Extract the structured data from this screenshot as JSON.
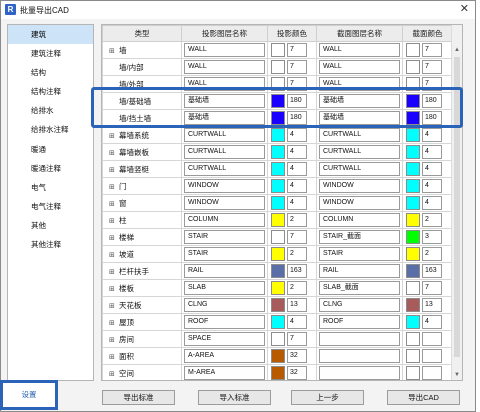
{
  "window": {
    "title": "批量导出CAD",
    "app_icon_letter": "R",
    "close_glyph": "✕"
  },
  "sidebar": {
    "items": [
      {
        "label": "建筑",
        "active": true
      },
      {
        "label": "建筑注释"
      },
      {
        "label": "结构"
      },
      {
        "label": "结构注释"
      },
      {
        "label": "给排水"
      },
      {
        "label": "给排水注释"
      },
      {
        "label": "暖通"
      },
      {
        "label": "暖通注释"
      },
      {
        "label": "电气"
      },
      {
        "label": "电气注释"
      },
      {
        "label": "其他"
      },
      {
        "label": "其他注释"
      }
    ]
  },
  "table": {
    "headers": [
      "类型",
      "投影图层名称",
      "投影颜色",
      "截面图层名称",
      "截面颜色"
    ],
    "rows": [
      {
        "type": "墙",
        "expand": "⊞",
        "proj_layer": "WALL",
        "proj_color": "#ffffff",
        "proj_num": "7",
        "sec_layer": "WALL",
        "sec_color": "#ffffff",
        "sec_num": "7"
      },
      {
        "type": "墙/内部",
        "expand": "",
        "proj_layer": "WALL",
        "proj_color": "#ffffff",
        "proj_num": "7",
        "sec_layer": "WALL",
        "sec_color": "#ffffff",
        "sec_num": "7"
      },
      {
        "type": "墙/外部",
        "expand": "",
        "proj_layer": "WALL",
        "proj_color": "#ffffff",
        "proj_num": "7",
        "sec_layer": "WALL",
        "sec_color": "#ffffff",
        "sec_num": "7"
      },
      {
        "type": "墙/基础墙",
        "expand": "",
        "proj_layer": "基础墙",
        "proj_color": "#1a00ff",
        "proj_num": "180",
        "sec_layer": "基础墙",
        "sec_color": "#1a00ff",
        "sec_num": "180"
      },
      {
        "type": "墙/挡土墙",
        "expand": "",
        "proj_layer": "基础墙",
        "proj_color": "#1a00ff",
        "proj_num": "180",
        "sec_layer": "基础墙",
        "sec_color": "#1a00ff",
        "sec_num": "180"
      },
      {
        "type": "幕墙系统",
        "expand": "⊞",
        "proj_layer": "CURTWALL",
        "proj_color": "#00ffff",
        "proj_num": "4",
        "sec_layer": "CURTWALL",
        "sec_color": "#00ffff",
        "sec_num": "4"
      },
      {
        "type": "幕墙嵌板",
        "expand": "⊞",
        "proj_layer": "CURTWALL",
        "proj_color": "#00ffff",
        "proj_num": "4",
        "sec_layer": "CURTWALL",
        "sec_color": "#00ffff",
        "sec_num": "4"
      },
      {
        "type": "幕墙竖梃",
        "expand": "⊞",
        "proj_layer": "CURTWALL",
        "proj_color": "#00ffff",
        "proj_num": "4",
        "sec_layer": "CURTWALL",
        "sec_color": "#00ffff",
        "sec_num": "4"
      },
      {
        "type": "门",
        "expand": "⊞",
        "proj_layer": "WINDOW",
        "proj_color": "#00ffff",
        "proj_num": "4",
        "sec_layer": "WINDOW",
        "sec_color": "#00ffff",
        "sec_num": "4"
      },
      {
        "type": "窗",
        "expand": "⊞",
        "proj_layer": "WINDOW",
        "proj_color": "#00ffff",
        "proj_num": "4",
        "sec_layer": "WINDOW",
        "sec_color": "#00ffff",
        "sec_num": "4"
      },
      {
        "type": "柱",
        "expand": "⊞",
        "proj_layer": "COLUMN",
        "proj_color": "#ffff00",
        "proj_num": "2",
        "sec_layer": "COLUMN",
        "sec_color": "#ffff00",
        "sec_num": "2"
      },
      {
        "type": "楼梯",
        "expand": "⊞",
        "proj_layer": "STAIR",
        "proj_color": "#ffffff",
        "proj_num": "7",
        "sec_layer": "STAIR_截面",
        "sec_color": "#00ff00",
        "sec_num": "3"
      },
      {
        "type": "坡道",
        "expand": "⊞",
        "proj_layer": "STAIR",
        "proj_color": "#ffff00",
        "proj_num": "2",
        "sec_layer": "STAIR",
        "sec_color": "#ffff00",
        "sec_num": "2"
      },
      {
        "type": "栏杆扶手",
        "expand": "⊞",
        "proj_layer": "RAIL",
        "proj_color": "#5a6fa8",
        "proj_num": "163",
        "sec_layer": "RAIL",
        "sec_color": "#5a6fa8",
        "sec_num": "163"
      },
      {
        "type": "楼板",
        "expand": "⊞",
        "proj_layer": "SLAB",
        "proj_color": "#ffff00",
        "proj_num": "2",
        "sec_layer": "SLAB_截面",
        "sec_color": "#ffffff",
        "sec_num": "7"
      },
      {
        "type": "天花板",
        "expand": "⊞",
        "proj_layer": "CLNG",
        "proj_color": "#a85b5b",
        "proj_num": "13",
        "sec_layer": "CLNG",
        "sec_color": "#a85b5b",
        "sec_num": "13"
      },
      {
        "type": "屋顶",
        "expand": "⊞",
        "proj_layer": "ROOF",
        "proj_color": "#00ffff",
        "proj_num": "4",
        "sec_layer": "ROOF",
        "sec_color": "#00ffff",
        "sec_num": "4"
      },
      {
        "type": "房间",
        "expand": "⊞",
        "proj_layer": "SPACE",
        "proj_color": "#ffffff",
        "proj_num": "7",
        "sec_layer": "",
        "sec_color": "#ffffff",
        "sec_num": ""
      },
      {
        "type": "面积",
        "expand": "⊞",
        "proj_layer": "A-AREA",
        "proj_color": "#b85a00",
        "proj_num": "32",
        "sec_layer": "",
        "sec_color": "#ffffff",
        "sec_num": ""
      },
      {
        "type": "空间",
        "expand": "⊞",
        "proj_layer": "M-AREA",
        "proj_color": "#b85a00",
        "proj_num": "32",
        "sec_layer": "",
        "sec_color": "#ffffff",
        "sec_num": ""
      }
    ]
  },
  "footer": {
    "settings_label": "设置",
    "export_standard_label": "导出标准",
    "import_standard_label": "导入标准",
    "prev_label": "上一步",
    "export_cad_label": "导出CAD"
  },
  "highlight_color": "#2b63b8"
}
